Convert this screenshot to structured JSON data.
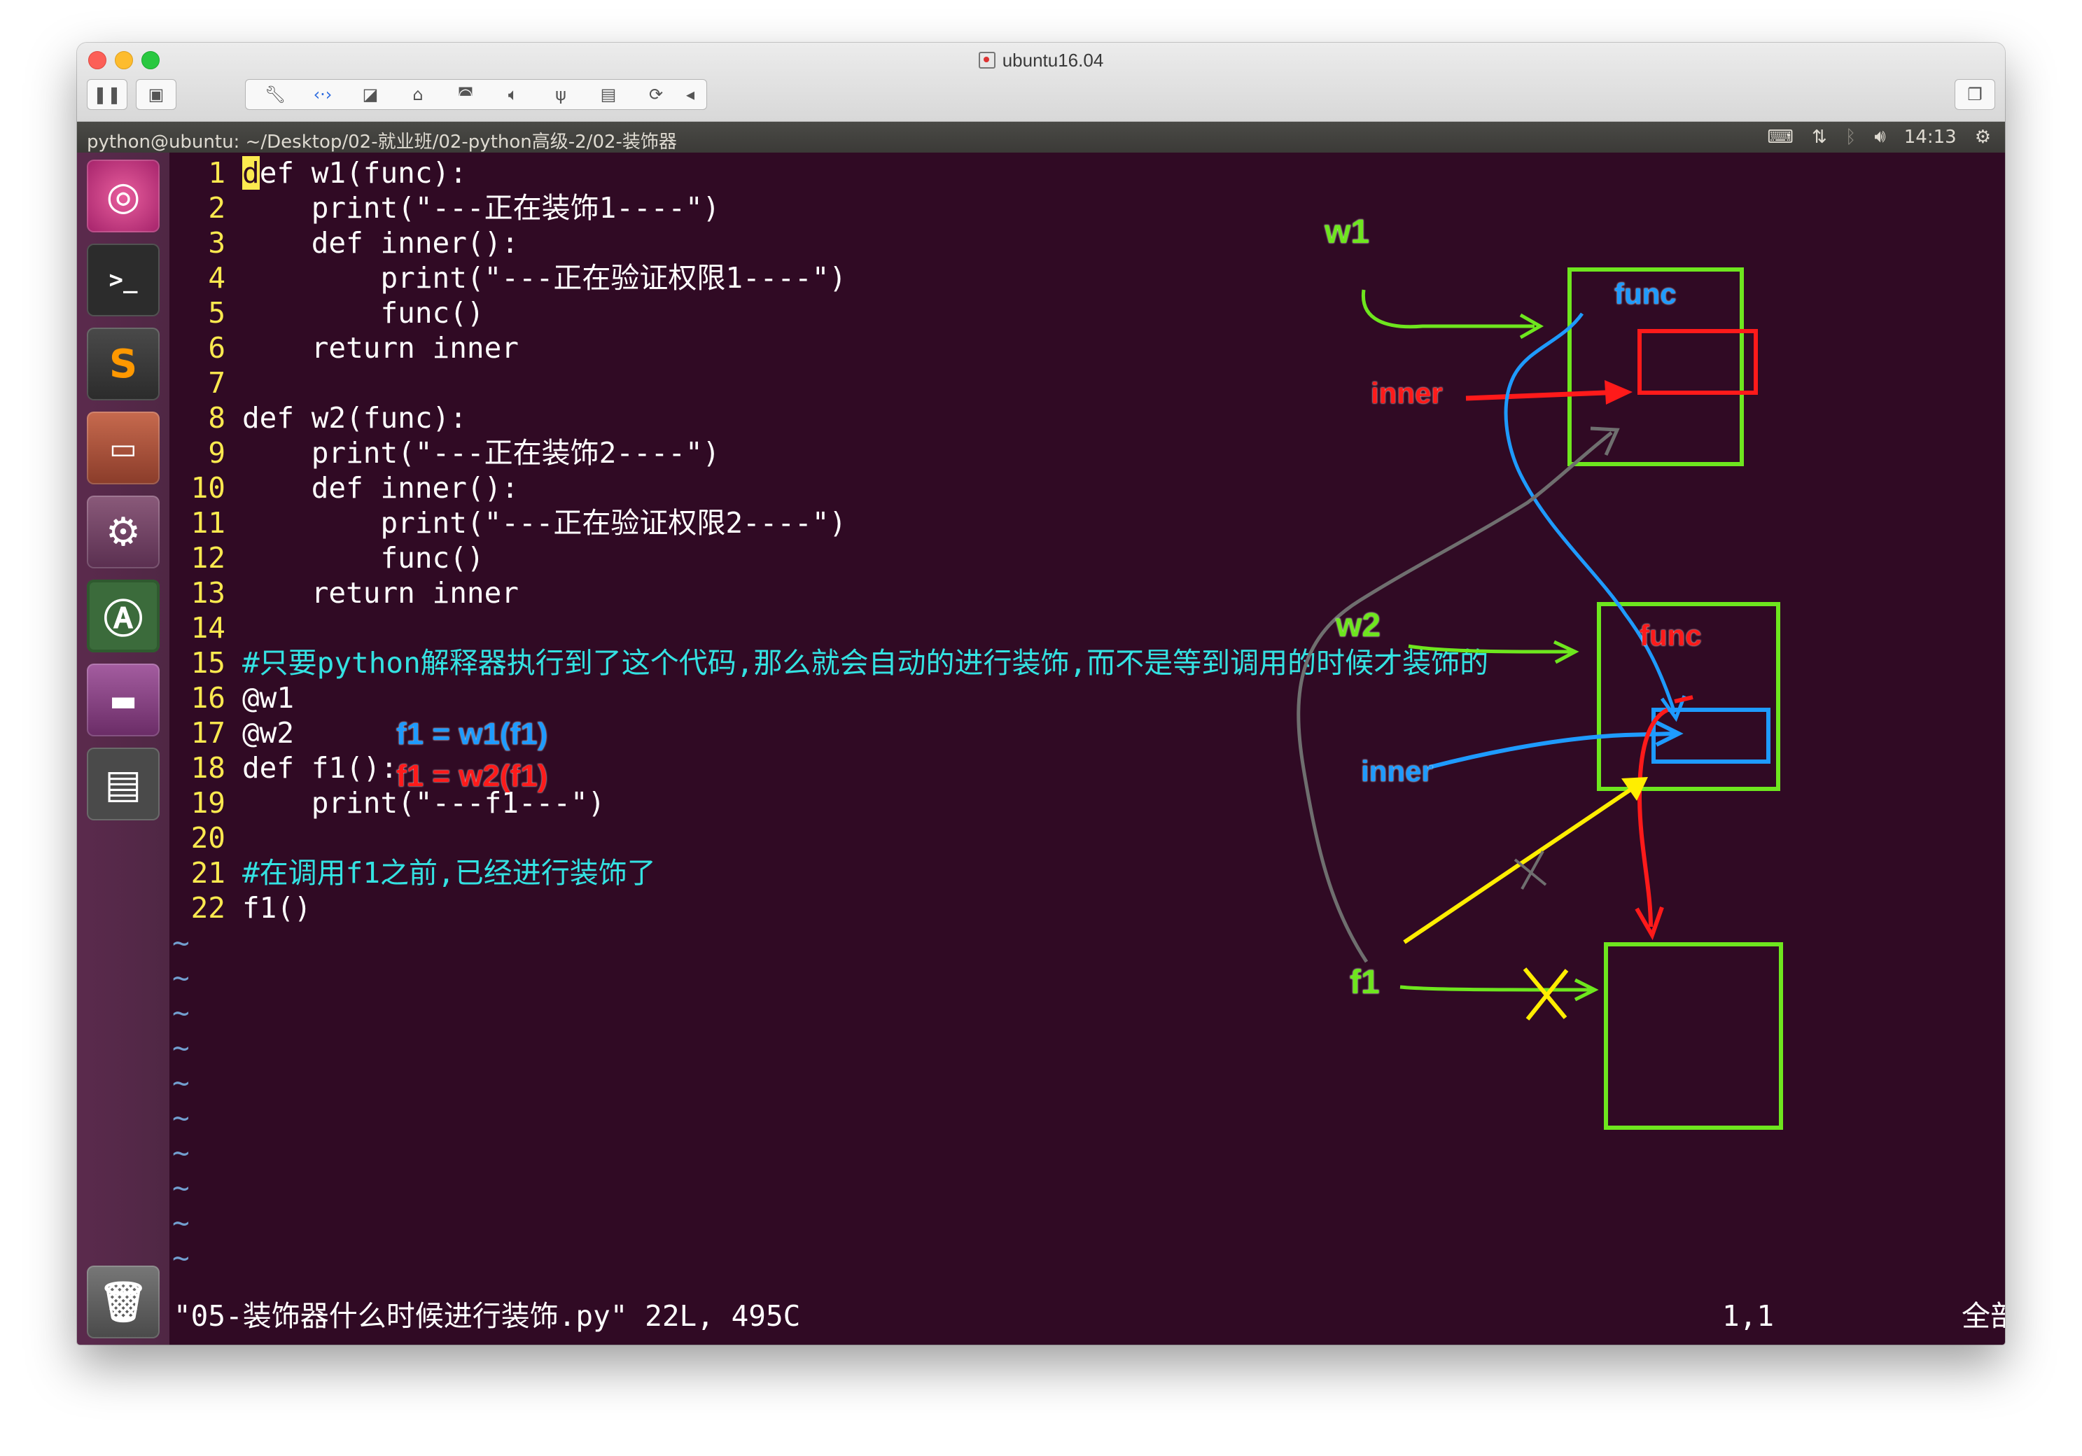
{
  "window": {
    "title": "ubuntu16.04"
  },
  "toolbar": {
    "left_icons": [
      "pause-icon",
      "snapshot-icon"
    ],
    "group_icons": [
      "wrench-icon",
      "network-icon",
      "disk-icon",
      "printer-icon",
      "camera-icon",
      "speaker-icon",
      "usb-icon",
      "floppy-icon",
      "refresh-icon",
      "collapse-arrow-icon"
    ],
    "right_icons": [
      "restore-icon"
    ]
  },
  "menubar": {
    "path": "python@ubuntu: ~/Desktop/02-就业班/02-python高级-2/02-装饰器",
    "time": "14:13",
    "tray_icons": [
      "keyboard-icon",
      "network-arrows-icon",
      "bluetooth-icon",
      "volume-icon",
      "power-gear-icon"
    ]
  },
  "launcher": {
    "items": [
      "ubuntu-dash-icon",
      "terminal-icon",
      "sublime-text-icon",
      "file-manager-icon",
      "system-settings-icon",
      "software-updater-icon",
      "workspace-switcher-icon",
      "save-disk-icon",
      "trash-icon"
    ]
  },
  "editor": {
    "lines": [
      {
        "n": "1",
        "text": "def w1(func):"
      },
      {
        "n": "2",
        "text": "    print(\"---正在装饰1----\")"
      },
      {
        "n": "3",
        "text": "    def inner():"
      },
      {
        "n": "4",
        "text": "        print(\"---正在验证权限1----\")"
      },
      {
        "n": "5",
        "text": "        func()"
      },
      {
        "n": "6",
        "text": "    return inner"
      },
      {
        "n": "7",
        "text": ""
      },
      {
        "n": "8",
        "text": "def w2(func):"
      },
      {
        "n": "9",
        "text": "    print(\"---正在装饰2----\")"
      },
      {
        "n": "10",
        "text": "    def inner():"
      },
      {
        "n": "11",
        "text": "        print(\"---正在验证权限2----\")"
      },
      {
        "n": "12",
        "text": "        func()"
      },
      {
        "n": "13",
        "text": "    return inner"
      },
      {
        "n": "14",
        "text": ""
      },
      {
        "n": "15",
        "text": "#只要python解释器执行到了这个代码,那么就会自动的进行装饰,而不是等到调用的时候才装饰的"
      },
      {
        "n": "16",
        "text": "@w1"
      },
      {
        "n": "17",
        "text": "@w2"
      },
      {
        "n": "18",
        "text": "def f1():"
      },
      {
        "n": "19",
        "text": "    print(\"---f1---\")"
      },
      {
        "n": "20",
        "text": ""
      },
      {
        "n": "21",
        "text": "#在调用f1之前,已经进行装饰了"
      },
      {
        "n": "22",
        "text": "f1()"
      }
    ],
    "tilde": "~",
    "status_file": "\"05-装饰器什么时候进行装饰.py\" 22L, 495C",
    "status_pos": "1,1",
    "status_all": "全部"
  },
  "annotations": {
    "f1_w1": "f1 = w1(f1)",
    "f1_w2": "f1 = w2(f1)",
    "w1": "w1",
    "w2": "w2",
    "inner_top": "inner",
    "inner_mid": "inner",
    "func_top": "func",
    "func_mid": "func",
    "f1": "f1"
  },
  "colors": {
    "terminal_bg": "#300a24",
    "line_number": "#fce94f",
    "comment": "#34e2e2",
    "ann_green": "#6ee61e",
    "ann_red": "#ff1a1a",
    "ann_blue": "#1e9bff",
    "ann_yellow": "#ffee00",
    "ann_gray": "#6f6f6f"
  }
}
